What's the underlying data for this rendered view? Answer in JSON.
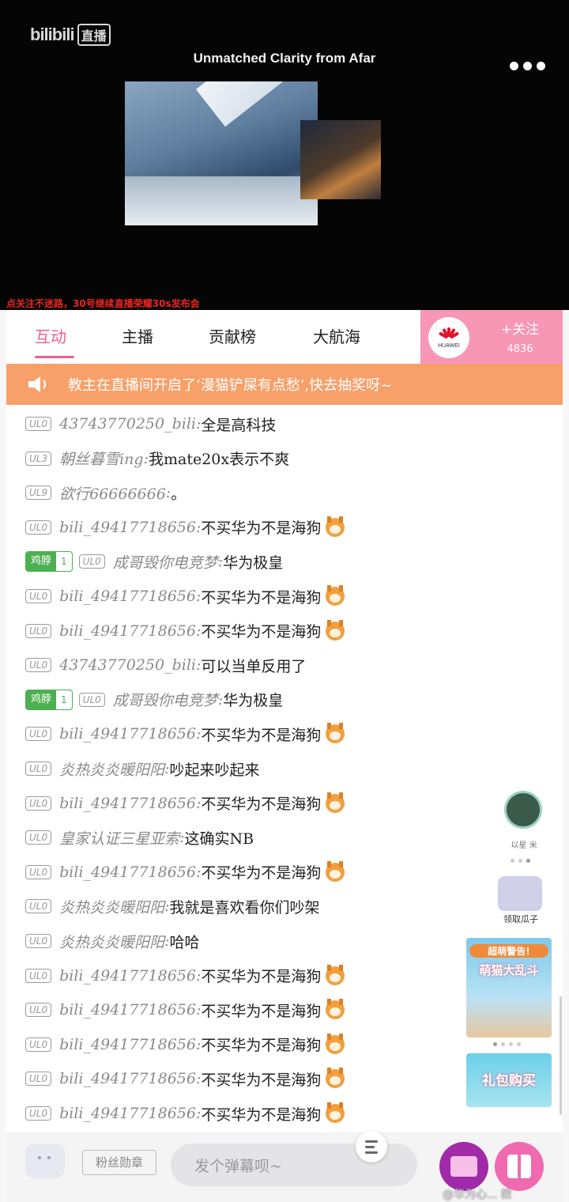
{
  "video": {
    "logo_text": "bilibili",
    "logo_badge": "直播",
    "title": "Unmatched Clarity from Afar",
    "ticker": "点关注不迷路，30号继续直播荣耀30s发布会"
  },
  "tabs": {
    "items": [
      "互动",
      "主播",
      "贡献榜",
      "大航海"
    ],
    "active_index": 0
  },
  "streamer": {
    "badge_text": "HUAWEI",
    "follow_label": "+关注",
    "follow_count": "4836"
  },
  "notice": {
    "text": "教主在直播间开启了‘漫猫铲屎有点愁’,快去抽奖呀~"
  },
  "chat": {
    "messages": [
      {
        "level": "UL0",
        "user": "43743770250_bili",
        "text": "全是高科技"
      },
      {
        "level": "UL3",
        "user": "朝丝暮雪ing",
        "text": "我mate20x表示不爽"
      },
      {
        "level": "UL9",
        "user": "欲行66666666",
        "text": "。"
      },
      {
        "level": "UL0",
        "user": "bili_49417718656",
        "text": "不买华为不是海狗"
      },
      {
        "level": "UL0",
        "medal": "鸡脖",
        "medal_level": "1",
        "user": "成哥毁你电竞梦",
        "text": "华为极皇"
      },
      {
        "level": "UL0",
        "user": "bili_49417718656",
        "text": "不买华为不是海狗"
      },
      {
        "level": "UL0",
        "user": "bili_49417718656",
        "text": "不买华为不是海狗"
      },
      {
        "level": "UL0",
        "user": "43743770250_bili",
        "text": "可以当单反用了"
      },
      {
        "level": "UL0",
        "medal": "鸡脖",
        "medal_level": "1",
        "user": "成哥毁你电竞梦",
        "text": "华为极皇"
      },
      {
        "level": "UL0",
        "user": "bili_49417718656",
        "text": "不买华为不是海狗"
      },
      {
        "level": "UL0",
        "user": "炎热炎炎暖阳阳",
        "text": "吵起来吵起来"
      },
      {
        "level": "UL0",
        "user": "bili_49417718656",
        "text": "不买华为不是海狗"
      },
      {
        "level": "UL0",
        "user": "皇家认证三星亚索",
        "text": "这确实NB"
      },
      {
        "level": "UL0",
        "user": "bili_49417718656",
        "text": "不买华为不是海狗"
      },
      {
        "level": "UL0",
        "user": "炎热炎炎暖阳阳",
        "text": "我就是喜欢看你们吵架"
      },
      {
        "level": "UL0",
        "user": "炎热炎炎暖阳阳",
        "text": "哈哈"
      },
      {
        "level": "UL0",
        "user": "bili_49417718656",
        "text": "不买华为不是海狗"
      },
      {
        "level": "UL0",
        "user": "bili_49417718656",
        "text": "不买华为不是海狗"
      },
      {
        "level": "UL0",
        "user": "bili_49417718656",
        "text": "不买华为不是海狗"
      },
      {
        "level": "UL0",
        "user": "bili_49417718656",
        "text": "不买华为不是海狗"
      },
      {
        "level": "UL0",
        "user": "bili_49417718656",
        "text": "不买华为不是海狗"
      }
    ]
  },
  "side": {
    "avatar_caption": "以星  米",
    "box_caption": "领取瓜子",
    "banner1_line1": "超萌警告!",
    "banner1_line2": "萌猫大乱斗",
    "banner2": "礼包购买"
  },
  "bottom": {
    "fans_medal_label": "粉丝勋章",
    "input_placeholder": "发个弹幕呗~"
  },
  "watermark": "@华为心... 教"
}
